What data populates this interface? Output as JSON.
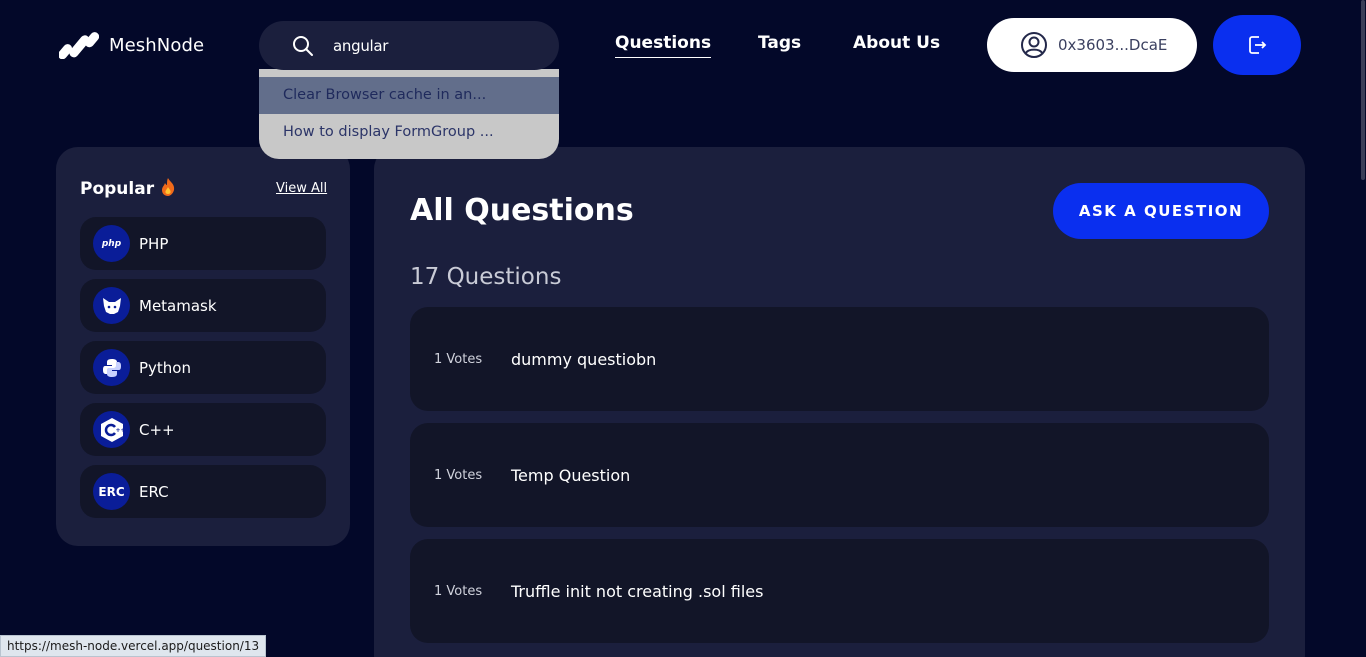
{
  "brand": {
    "name": "MeshNode",
    "icon": "meshnode-logo-icon"
  },
  "search": {
    "value": "angular",
    "icon": "search-icon"
  },
  "suggestions": [
    {
      "label": "Clear Browser cache in an..."
    },
    {
      "label": "How to display FormGroup ..."
    }
  ],
  "nav": {
    "questions": "Questions",
    "tags": "Tags",
    "about": "About Us"
  },
  "wallet": {
    "address": "0x3603...DcaE",
    "icon": "user-circle-icon"
  },
  "logout": {
    "icon": "logout-icon"
  },
  "sidebar": {
    "title": "Popular",
    "title_icon": "fire-icon",
    "view_all": "View All",
    "tags": [
      {
        "label": "PHP",
        "icon": "php-icon",
        "badge": "php"
      },
      {
        "label": "Metamask",
        "icon": "metamask-icon",
        "badge": ""
      },
      {
        "label": "Python",
        "icon": "python-icon",
        "badge": ""
      },
      {
        "label": "C++",
        "icon": "cplusplus-icon",
        "badge": ""
      },
      {
        "label": "ERC",
        "icon": "erc-icon",
        "badge": "ERC"
      }
    ]
  },
  "main": {
    "title": "All Questions",
    "ask_button": "ASK A QUESTION",
    "count": "17 Questions",
    "questions": [
      {
        "votes": "1 Votes",
        "title": "dummy questiobn"
      },
      {
        "votes": "1 Votes",
        "title": "Temp Question"
      },
      {
        "votes": "1 Votes",
        "title": "Truffle init not creating .sol files"
      }
    ]
  },
  "status_url": "https://mesh-node.vercel.app/question/13",
  "colors": {
    "background": "#030829",
    "panel": "#1b1f3d",
    "card": "#121528",
    "accent": "#0a2fef",
    "badge": "#0a1d98"
  }
}
